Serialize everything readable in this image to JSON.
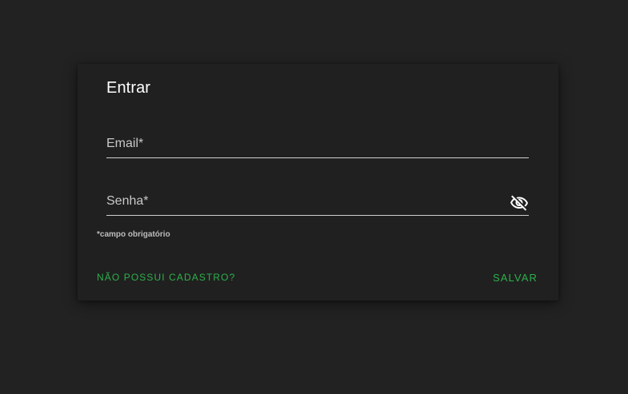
{
  "dialog": {
    "title": "Entrar",
    "email": {
      "label": "Email*",
      "value": ""
    },
    "password": {
      "label": "Senha*",
      "value": "",
      "toggle_icon": "eye-off-icon"
    },
    "helper_text": "*campo obrigatório",
    "register_link": "NÃO POSSUI CADASTRO?",
    "save_button": "SALVAR"
  },
  "colors": {
    "background": "#222222",
    "card": "#202020",
    "accent": "#2db04b",
    "text": "#ffffff"
  }
}
